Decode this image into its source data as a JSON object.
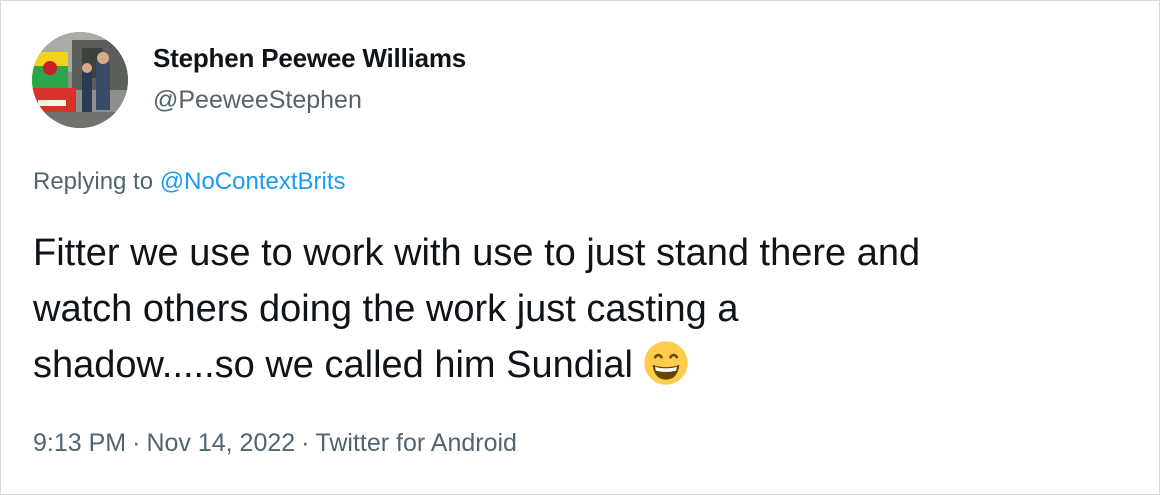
{
  "author": {
    "display_name": "Stephen Peewee Williams",
    "handle": "@PeeweeStephen"
  },
  "reply": {
    "prefix": "Replying to",
    "mention": "@NoContextBrits"
  },
  "tweet": {
    "lines": [
      "Fitter we use to work with use to just stand there and",
      "watch others doing the work just casting a",
      "shadow.....so we called him Sundial"
    ],
    "emoji_icon": "grinning-face-with-smiling-eyes-icon"
  },
  "meta": {
    "time": "9:13 PM",
    "separator": "·",
    "date": "Nov 14, 2022",
    "source": "Twitter for Android"
  },
  "colors": {
    "text_primary": "#0f1419",
    "text_secondary": "#536471",
    "link": "#1d9bf0",
    "border": "#cfd9de"
  }
}
